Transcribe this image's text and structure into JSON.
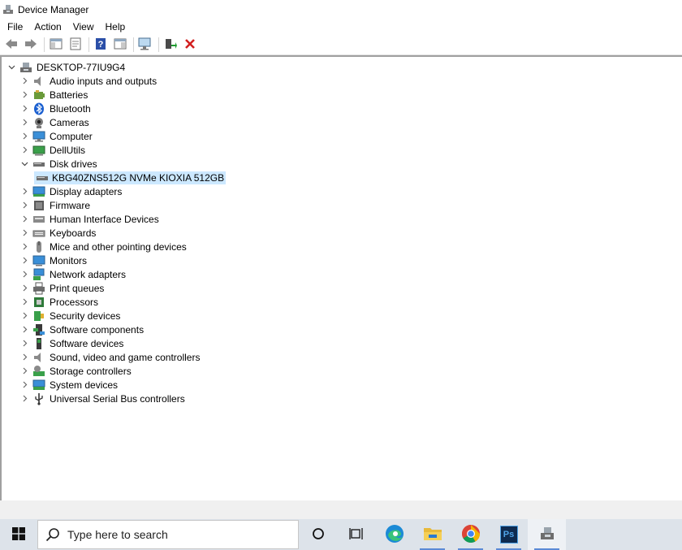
{
  "window": {
    "title": "Device Manager"
  },
  "menu": [
    "File",
    "Action",
    "View",
    "Help"
  ],
  "toolbar": {
    "buttons": [
      "back-icon",
      "forward-icon",
      "show-hide-console-tree-icon",
      "properties-icon",
      "help-icon",
      "action-pane-icon",
      "scan-hardware-icon",
      "enable-device-icon",
      "uninstall-device-icon"
    ]
  },
  "tree": {
    "root": "DESKTOP-77IU9G4",
    "categories": [
      {
        "label": "Audio inputs and outputs",
        "icon": "speaker-icon"
      },
      {
        "label": "Batteries",
        "icon": "battery-icon"
      },
      {
        "label": "Bluetooth",
        "icon": "bluetooth-icon"
      },
      {
        "label": "Cameras",
        "icon": "camera-icon"
      },
      {
        "label": "Computer",
        "icon": "computer-icon"
      },
      {
        "label": "DellUtils",
        "icon": "dellutils-icon"
      },
      {
        "label": "Disk drives",
        "icon": "disk-drive-icon",
        "expanded": true,
        "children": [
          "KBG40ZNS512G NVMe KIOXIA 512GB"
        ]
      },
      {
        "label": "Display adapters",
        "icon": "display-adapter-icon"
      },
      {
        "label": "Firmware",
        "icon": "firmware-icon"
      },
      {
        "label": "Human Interface Devices",
        "icon": "hid-icon"
      },
      {
        "label": "Keyboards",
        "icon": "keyboard-icon"
      },
      {
        "label": "Mice and other pointing devices",
        "icon": "mouse-icon"
      },
      {
        "label": "Monitors",
        "icon": "monitor-icon"
      },
      {
        "label": "Network adapters",
        "icon": "network-adapter-icon"
      },
      {
        "label": "Print queues",
        "icon": "printer-icon"
      },
      {
        "label": "Processors",
        "icon": "processor-icon"
      },
      {
        "label": "Security devices",
        "icon": "security-device-icon"
      },
      {
        "label": "Software components",
        "icon": "software-component-icon"
      },
      {
        "label": "Software devices",
        "icon": "software-device-icon"
      },
      {
        "label": "Sound, video and game controllers",
        "icon": "sound-controller-icon"
      },
      {
        "label": "Storage controllers",
        "icon": "storage-controller-icon"
      },
      {
        "label": "System devices",
        "icon": "system-device-icon"
      },
      {
        "label": "Universal Serial Bus controllers",
        "icon": "usb-icon"
      }
    ]
  },
  "taskbar": {
    "search_placeholder": "Type here to search",
    "apps": [
      "cortana-icon",
      "task-view-icon",
      "edge-icon",
      "file-explorer-icon",
      "chrome-icon",
      "photoshop-icon",
      "device-manager-icon"
    ],
    "photoshop_label": "Ps"
  },
  "colors": {
    "selection": "#cce8ff",
    "taskbar": "#dde3ea",
    "uninstall_red": "#d21f1f"
  }
}
